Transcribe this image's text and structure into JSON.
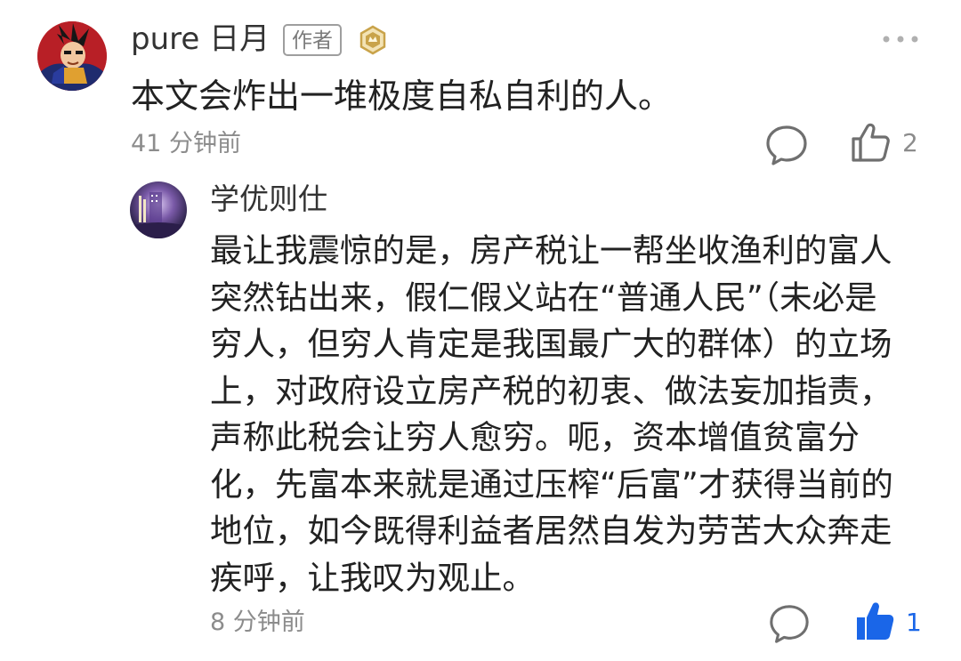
{
  "comment": {
    "author": "pure 日月",
    "badge": "作者",
    "text": "本文会炸出一堆极度自私自利的人。",
    "time": "41 分钟前",
    "like_count": "2",
    "icons": {
      "avatar": "cartoon-avatar",
      "level": "level-badge-icon",
      "more": "more-dots-icon",
      "reply": "comment-bubble-icon",
      "like": "thumbs-up-outline-icon"
    }
  },
  "reply": {
    "author": "学优则仕",
    "lines": [
      "最让我震惊的是，房产税让一帮坐收渔利的富人",
      "突然钻出来，假仁假义站在“普通人民”（未必是",
      "穷人，但穷人肯定是我国最广大的群体）的立场",
      "上，对政府设立房产税的初衷、做法妄加指责，",
      "声称此税会让穷人愈穷。呃，资本增值贫富分",
      "化，先富本来就是通过压榨“后富”才获得当前的",
      "地位，如今既得利益者居然自发为劳苦大众奔走",
      "疾呼，让我叹为观止。"
    ],
    "time": "8 分钟前",
    "like_count": "1",
    "liked": true,
    "icons": {
      "avatar": "night-scene-avatar",
      "reply": "comment-bubble-icon",
      "like": "thumbs-up-filled-icon"
    }
  },
  "colors": {
    "liked_blue": "#1a66e8",
    "meta_gray": "#8c8c8c",
    "text_dark": "#222222",
    "badge_gold": "#c9a34a"
  }
}
